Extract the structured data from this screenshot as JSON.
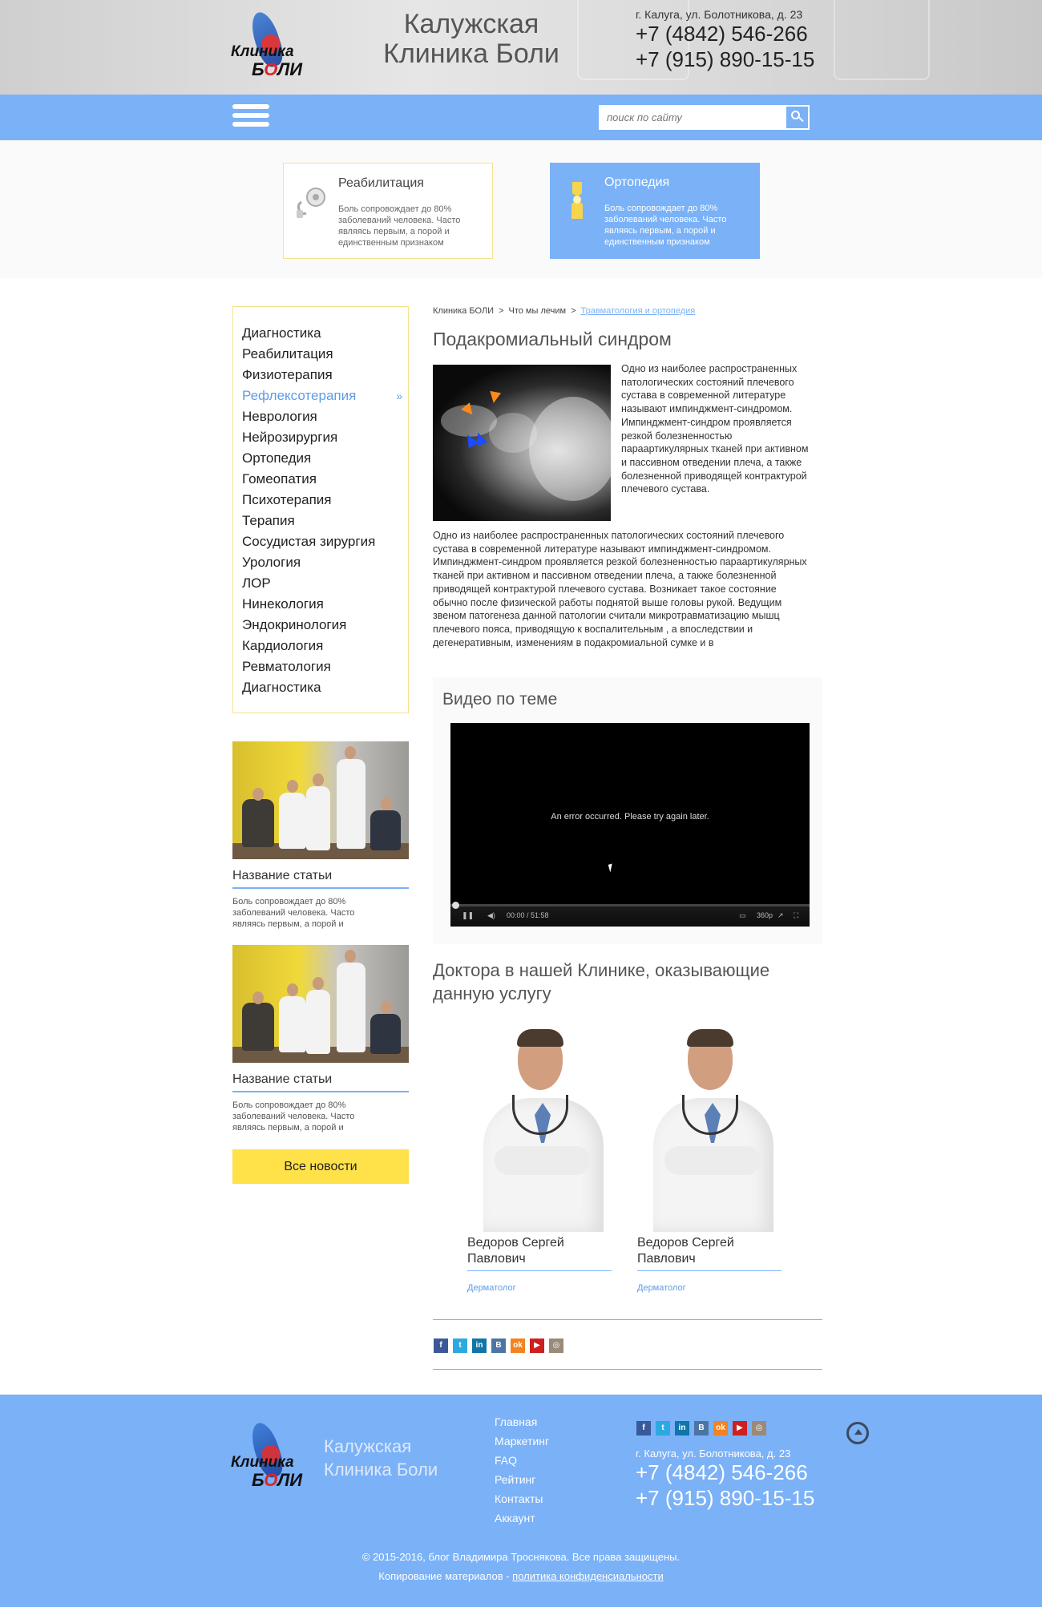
{
  "header": {
    "logo_line1": "Клиника",
    "logo_line2_a": "Б",
    "logo_line2_o": "О",
    "logo_line2_b": "ЛИ",
    "site_name_1": "Калужская",
    "site_name_2": "Клиника Боли",
    "address": "г. Калуга, ул. Болотникова, д. 23",
    "phone1": "+7 (4842) 546-266",
    "phone2": "+7 (915) 890-15-15"
  },
  "nav": {
    "search_placeholder": "поиск по сайту",
    "menu_icon": "hamburger-icon",
    "search_icon": "search-icon"
  },
  "services": [
    {
      "title": "Реабилитация",
      "desc": "Боль сопровождает до 80% заболеваний человека. Часто являясь первым, а порой и единственным признаком",
      "icon": "blood-pressure-icon"
    },
    {
      "title": "Ортопедия",
      "desc": "Боль сопровождает до 80% заболеваний человека. Часто являясь первым, а порой и единственным признаком",
      "icon": "joint-icon"
    }
  ],
  "sidebar": {
    "items": [
      {
        "label": "Диагностика"
      },
      {
        "label": "Реабилитация"
      },
      {
        "label": "Физиотерапия"
      },
      {
        "label": "Рефлексотерапия",
        "active": true
      },
      {
        "label": "Неврология"
      },
      {
        "label": "Нейрозирургия"
      },
      {
        "label": "Ортопедия"
      },
      {
        "label": "Гомеопатия"
      },
      {
        "label": "Психотерапия"
      },
      {
        "label": "Терапия"
      },
      {
        "label": "Сосудистая зирургия"
      },
      {
        "label": "Урология"
      },
      {
        "label": "ЛОР"
      },
      {
        "label": "Нинекология"
      },
      {
        "label": "Эндокринология"
      },
      {
        "label": "Кардиология"
      },
      {
        "label": "Ревматология"
      },
      {
        "label": "Диагностика"
      }
    ],
    "active_chevron": "»"
  },
  "news": [
    {
      "title": "Название статьи",
      "desc": "Боль сопровождает до 80% заболеваний человека. Часто являясь первым, а порой и"
    },
    {
      "title": "Название статьи",
      "desc": "Боль сопровождает до 80% заболеваний человека. Часто являясь первым, а порой и"
    }
  ],
  "all_news_label": "Все новости",
  "breadcrumb": {
    "items": [
      "Клиника БОЛИ",
      "Что мы лечим"
    ],
    "current": "Травматология и ортопедия",
    "sep": ">"
  },
  "article": {
    "title": "Подакромиальный синдром",
    "intro": "Одно из наиболее распространенных патологических состояний плечевого сустава в современной литературе называют импинджмент-синдромом. Импинджмент-синдром проявляется резкой болезненностью параартикулярных тканей при активном и пассивном отведении плеча, а также болезненной приводящей контрактурой плечевого сустава.",
    "body": "Одно из наиболее распространенных патологических состояний плечевого сустава в современной литературе называют импинджмент-синдромом. Импинджмент-синдром проявляется резкой болезненностью параартикулярных тканей при активном и пассивном отведении плеча, а также болезненной приводящей контрактурой плечевого сустава. Возникает такое состояние обычно после физической работы поднятой выше головы рукой. Ведущим звеном патогенеза данной патологии считали микротравматизацию мышц плечевого пояса, приводящую к воспалительным , а впоследствии и дегенеративным, изменениям в подакромиальной сумке и в"
  },
  "video": {
    "title": "Видео по теме",
    "error": "An error occurred. Please try again later.",
    "time": "00:00 / 51:58",
    "quality": "360p"
  },
  "doctors": {
    "title": "Доктора в нашей Клинике, оказывающие данную услугу",
    "items": [
      {
        "name1": "Ведоров Сергей",
        "name2": "Павлович",
        "spec": "Дерматолог"
      },
      {
        "name1": "Ведоров Сергей",
        "name2": "Павлович",
        "spec": "Дерматолог"
      }
    ]
  },
  "socials": [
    {
      "icon": "facebook-icon",
      "glyph": "f",
      "color": "#3b5998"
    },
    {
      "icon": "twitter-icon",
      "glyph": "t",
      "color": "#2ca9e1"
    },
    {
      "icon": "linkedin-icon",
      "glyph": "in",
      "color": "#0e76a8"
    },
    {
      "icon": "vk-icon",
      "glyph": "B",
      "color": "#4c75a3"
    },
    {
      "icon": "odnoklassniki-icon",
      "glyph": "ok",
      "color": "#f58220"
    },
    {
      "icon": "youtube-icon",
      "glyph": "▶",
      "color": "#cd201f"
    },
    {
      "icon": "instagram-icon",
      "glyph": "◎",
      "color": "#9a8a7a"
    }
  ],
  "footer": {
    "site_name_1": "Калужская",
    "site_name_2": "Клиника Боли",
    "links": [
      "Главная",
      "Маркетинг",
      "FAQ",
      "Рейтинг",
      "Контакты",
      "Аккаунт"
    ],
    "address": "г. Калуга, ул. Болотникова, д. 23",
    "phone1": "+7 (4842) 546-266",
    "phone2": "+7 (915) 890-15-15",
    "copyright": "© 2015-2016, блог Владимира Троснякова. Все права защищены.",
    "copy_prefix": "Копирование материалов - ",
    "policy": "политика конфиденсиальности"
  },
  "colors": {
    "accent_blue": "#7ab1f7",
    "accent_yellow": "#ffe14a",
    "card_border": "#f5e28a"
  }
}
